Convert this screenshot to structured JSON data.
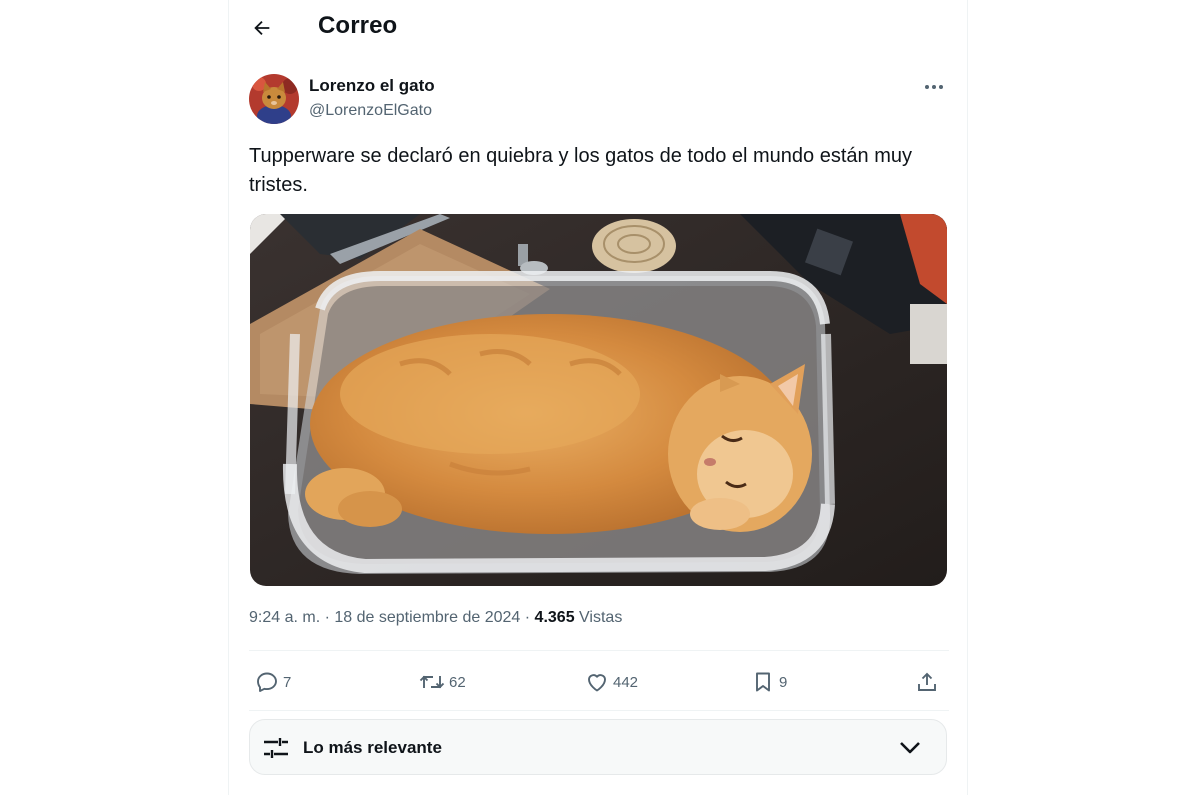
{
  "header": {
    "title": "Correo",
    "back_icon": "arrow-left-icon"
  },
  "tweet": {
    "author_name": "Lorenzo el gato",
    "author_handle": "@LorenzoElGato",
    "text": "Tupperware se declaró en quiebra y los gatos de todo el mundo están muy tristes.",
    "time": "9:24 a. m.",
    "separator": "·",
    "date": "18 de septiembre de 2024",
    "views_count": "4.365",
    "views_label": "Vistas",
    "media_description": "orange cat lying in plastic tupperware container",
    "stats": {
      "replies": "7",
      "reposts": "62",
      "likes": "442",
      "bookmarks": "9"
    }
  },
  "sort": {
    "label": "Lo más relevante",
    "icon": "sliders-icon"
  },
  "colors": {
    "text_primary": "#0f1419",
    "text_secondary": "#536471",
    "border": "#eff3f4",
    "sort_bg": "#f7f9f9"
  }
}
